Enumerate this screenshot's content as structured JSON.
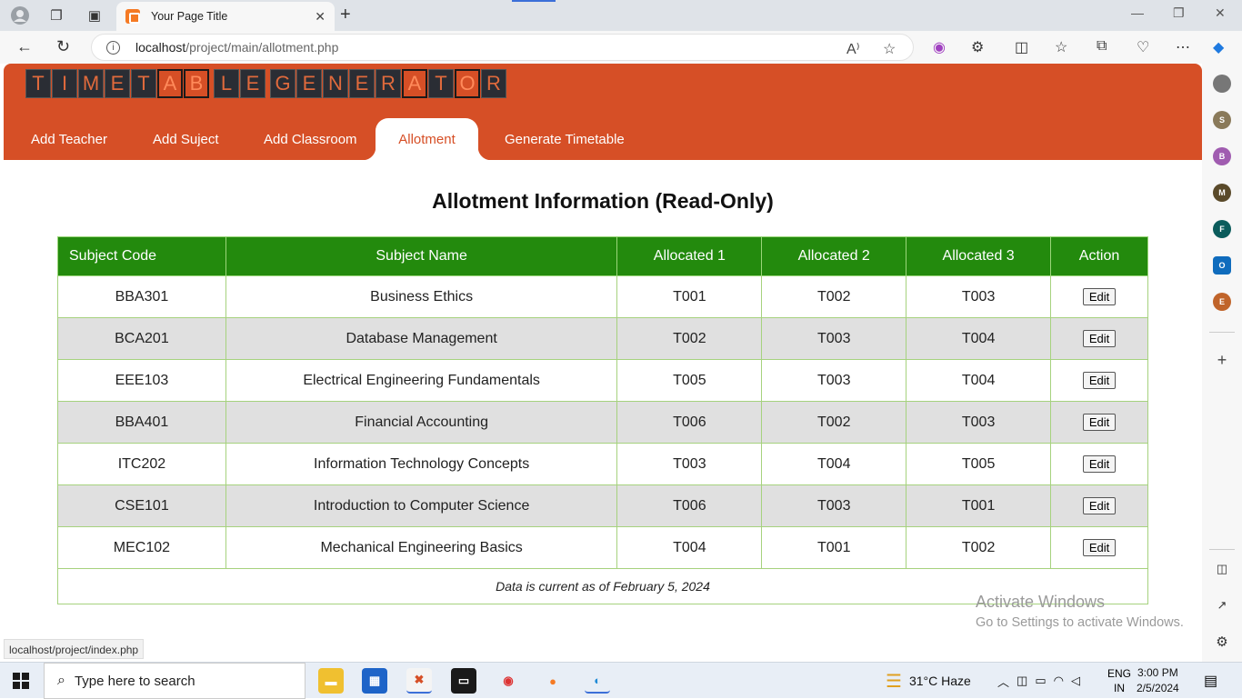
{
  "browser": {
    "tab_title": "Your Page Title",
    "url_host": "localhost",
    "url_path": "/project/main/allotment.php",
    "status_url": "localhost/project/index.php",
    "sidebar_avatars": [
      {
        "letter": "S",
        "color": "#8a7a5a"
      },
      {
        "letter": "B",
        "color": "#a05cb0"
      },
      {
        "letter": "M",
        "color": "#5a4a2a"
      },
      {
        "letter": "F",
        "color": "#0b5c5c"
      },
      {
        "letter": "O",
        "color": "#0f6cbd"
      },
      {
        "letter": "E",
        "color": "#c0642a"
      }
    ]
  },
  "app": {
    "logo_letters": [
      "T",
      "I",
      "M",
      "E",
      "T",
      "A",
      "B",
      "L",
      "E",
      "G",
      "E",
      "N",
      "E",
      "R",
      "A",
      "T",
      "O",
      "R"
    ],
    "nav": [
      "Add Teacher",
      "Add Suject",
      "Add Classroom",
      "Allotment",
      "Generate Timetable"
    ],
    "heading": "Allotment Information (Read-Only)",
    "columns": [
      "Subject Code",
      "Subject Name",
      "Allocated 1",
      "Allocated 2",
      "Allocated 3",
      "Action"
    ],
    "rows": [
      [
        "BBA301",
        "Business Ethics",
        "T001",
        "T002",
        "T003",
        "Edit"
      ],
      [
        "BCA201",
        "Database Management",
        "T002",
        "T003",
        "T004",
        "Edit"
      ],
      [
        "EEE103",
        "Electrical Engineering Fundamentals",
        "T005",
        "T003",
        "T004",
        "Edit"
      ],
      [
        "BBA401",
        "Financial Accounting",
        "T006",
        "T002",
        "T003",
        "Edit"
      ],
      [
        "ITC202",
        "Information Technology Concepts",
        "T003",
        "T004",
        "T005",
        "Edit"
      ],
      [
        "CSE101",
        "Introduction to Computer Science",
        "T006",
        "T003",
        "T001",
        "Edit"
      ],
      [
        "MEC102",
        "Mechanical Engineering Basics",
        "T004",
        "T001",
        "T002",
        "Edit"
      ]
    ],
    "footer_note": "Data is current as of February 5, 2024",
    "accent_color": "#d64f26",
    "table_header_color": "#238a0d"
  },
  "watermark": {
    "line1": "Activate Windows",
    "line2": "Go to Settings to activate Windows."
  },
  "taskbar": {
    "search_placeholder": "Type here to search",
    "weather": "31°C  Haze",
    "lang1": "ENG",
    "lang2": "IN",
    "time": "3:00 PM",
    "date": "2/5/2024"
  }
}
